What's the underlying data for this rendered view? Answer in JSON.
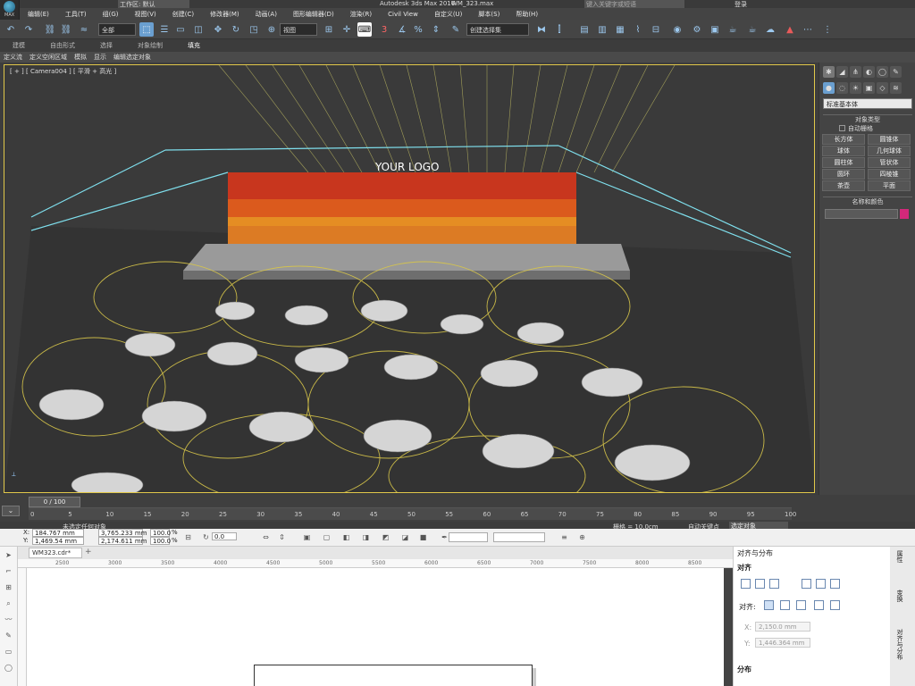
{
  "app": {
    "title": "Autodesk 3ds Max 2016",
    "file": "WM_323.max",
    "workspace_label": "工作区: 默认",
    "search_placeholder": "键入关键字或短语",
    "login_label": "登录",
    "max_logo": "MAX"
  },
  "menu": [
    "编辑(E)",
    "工具(T)",
    "组(G)",
    "视图(V)",
    "创建(C)",
    "修改器(M)",
    "动画(A)",
    "图形编辑器(D)",
    "渲染(R)",
    "Civil View",
    "自定义(U)",
    "脚本(S)",
    "帮助(H)"
  ],
  "toolbar": {
    "filter_value": "全部",
    "view_value": "视图",
    "selection_set": "创建选择集"
  },
  "ribbon_tabs": [
    "建模",
    "自由形式",
    "选择",
    "对象绘制",
    "填充"
  ],
  "ribbon_sub": [
    "定义流",
    "定义空闲区域",
    "模拟",
    "显示",
    "编辑选定对象"
  ],
  "viewport": {
    "label": "[ + ] [ Camera004 ] [ 平滑 + 高光 ]",
    "logo_text": "YOUR LOGO"
  },
  "command_panel": {
    "category": "标准基本体",
    "object_type_header": "对象类型",
    "autogrid": "自动栅格",
    "objects": [
      "长方体",
      "圆锥体",
      "球体",
      "几何球体",
      "圆柱体",
      "管状体",
      "圆环",
      "四棱锥",
      "茶壶",
      "平面"
    ],
    "name_color_header": "名称和颜色",
    "color": "#d4287a"
  },
  "timeline": {
    "frame": "0 / 100",
    "ticks": [
      "0",
      "5",
      "10",
      "15",
      "20",
      "25",
      "30",
      "35",
      "40",
      "45",
      "50",
      "55",
      "60",
      "65",
      "70",
      "75",
      "80",
      "85",
      "90",
      "95",
      "100"
    ]
  },
  "status": {
    "message": "未选定任何对象",
    "grid": "栅格 = 10.0cm",
    "autokey": "自动关键点",
    "selected": "选定对象"
  },
  "corel": {
    "x_label": "X:",
    "x_value": "184.767 mm",
    "y_label": "Y:",
    "y_value": "1,469.54 mm",
    "w_value": "3,765.233 mm",
    "h_value": "2,174.611 mm",
    "scale_x": "100.0",
    "scale_y": "100.0",
    "pct": "%",
    "angle": "0.0",
    "doc_tab": "WM323.cdr*",
    "ruler_ticks": [
      "2500",
      "3000",
      "3500",
      "4000",
      "4500",
      "5000",
      "5500",
      "6000",
      "6500",
      "7000",
      "7500",
      "8000",
      "8500"
    ]
  },
  "align_panel": {
    "title": "对齐与分布",
    "align_header": "对齐",
    "align_to": "对齐:",
    "x_label": "X:",
    "x_value": "2,150.0 mm",
    "y_label": "Y:",
    "y_value": "1,446.364 mm",
    "distribute_header": "分布"
  },
  "side_tabs": [
    "属性",
    "变换",
    "对齐与分布"
  ]
}
